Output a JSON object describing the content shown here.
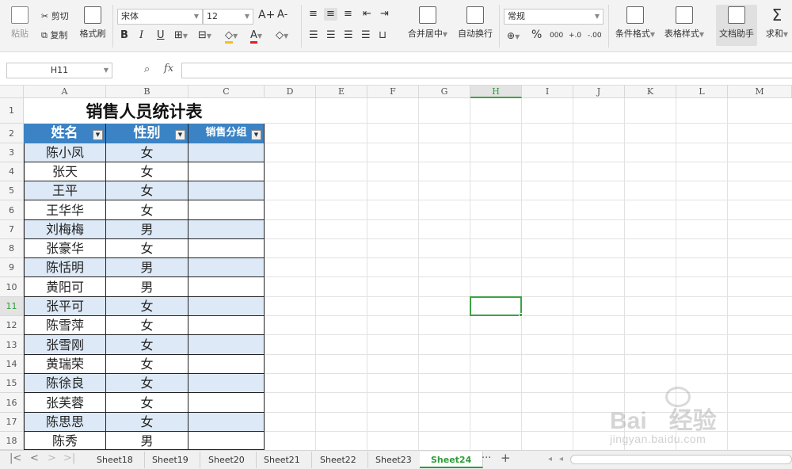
{
  "ribbon": {
    "paste_label": "粘贴",
    "cut_label": "剪切",
    "copy_label": "复制",
    "format_painter_label": "格式刷",
    "font_name": "宋体",
    "font_size": "12",
    "grow_font": "A+",
    "shrink_font": "A-",
    "bold": "B",
    "italic": "I",
    "underline": "U",
    "font_color_glyph": "A",
    "merge_center_label": "合并居中",
    "wrap_text_label": "自动换行",
    "number_format": "常规",
    "percent": "%",
    "thousands": "000",
    "inc_decimal": "+.0",
    "dec_decimal": "-.00",
    "cond_format_label": "条件格式",
    "table_style_label": "表格样式",
    "doc_assistant_label": "文档助手",
    "sum_label": "求和"
  },
  "formula_bar": {
    "name_box": "H11",
    "fx_label": "fx",
    "formula": ""
  },
  "columns": [
    "A",
    "B",
    "C",
    "D",
    "E",
    "F",
    "G",
    "H",
    "I",
    "J",
    "K",
    "L",
    "M"
  ],
  "rows": [
    "1",
    "2",
    "3",
    "4",
    "5",
    "6",
    "7",
    "8",
    "9",
    "10",
    "11",
    "12",
    "13",
    "14",
    "15",
    "16",
    "17",
    "18"
  ],
  "table": {
    "title": "销售人员统计表",
    "headers": [
      "姓名",
      "性别",
      "销售分组"
    ],
    "records": [
      [
        "陈小凤",
        "女",
        ""
      ],
      [
        "张天",
        "女",
        ""
      ],
      [
        "王平",
        "女",
        ""
      ],
      [
        "王华华",
        "女",
        ""
      ],
      [
        "刘梅梅",
        "男",
        ""
      ],
      [
        "张豪华",
        "女",
        ""
      ],
      [
        "陈恬明",
        "男",
        ""
      ],
      [
        "黄阳可",
        "男",
        ""
      ],
      [
        "张平可",
        "女",
        ""
      ],
      [
        "陈雪萍",
        "女",
        ""
      ],
      [
        "张雪刚",
        "女",
        ""
      ],
      [
        "黄瑞荣",
        "女",
        ""
      ],
      [
        "陈徐良",
        "女",
        ""
      ],
      [
        "张芙蓉",
        "女",
        ""
      ],
      [
        "陈思思",
        "女",
        ""
      ],
      [
        "陈秀",
        "男",
        ""
      ]
    ]
  },
  "selection": {
    "cell": "H11",
    "color": "#3ea245"
  },
  "sheet_tabs": [
    "Sheet18",
    "Sheet19",
    "Sheet20",
    "Sheet21",
    "Sheet22",
    "Sheet23",
    "Sheet24"
  ],
  "active_tab": "Sheet24",
  "tab_nav": {
    "first": "|<",
    "prev": "<",
    "next": ">",
    "last": ">|",
    "more": "···",
    "add": "+"
  },
  "watermark": {
    "brand": "Bai",
    "brand_cn": "经验",
    "url": "jingyan.baidu.com"
  },
  "colors": {
    "header_fill": "#3b83c4",
    "band_fill": "#dde9f6",
    "active_tab": "#2d9d3a"
  }
}
